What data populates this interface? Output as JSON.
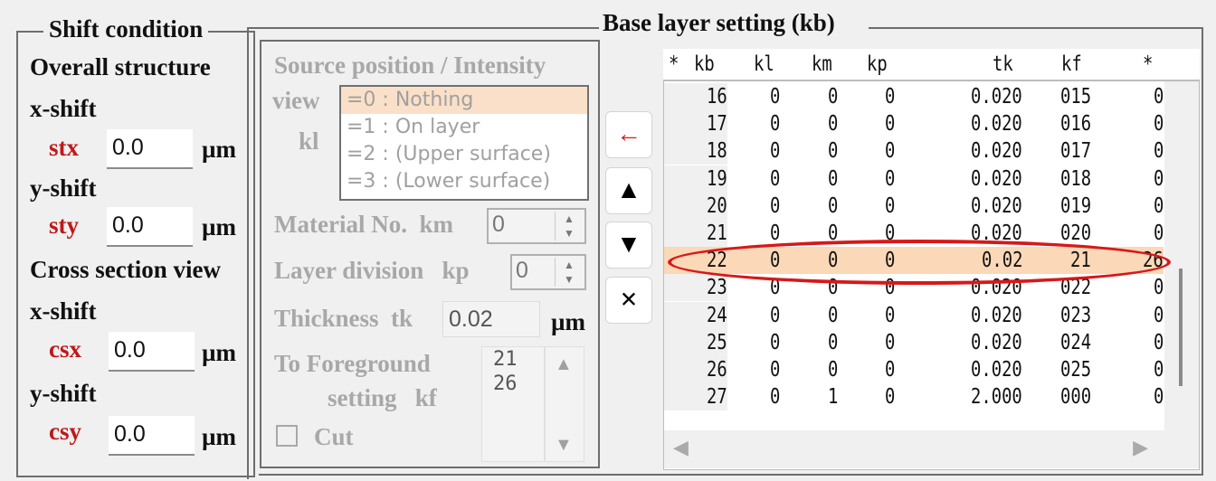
{
  "shift_condition": {
    "title": "Shift condition",
    "overall_structure": {
      "heading": "Overall structure",
      "x_shift_label": "x-shift",
      "stx": {
        "label": "stx",
        "value": "0.0",
        "unit": "µm"
      },
      "y_shift_label": "y-shift",
      "sty": {
        "label": "sty",
        "value": "0.0",
        "unit": "µm"
      }
    },
    "cross_section": {
      "heading": "Cross section view",
      "x_shift_label": "x-shift",
      "csx": {
        "label": "csx",
        "value": "0.0",
        "unit": "µm"
      },
      "y_shift_label": "y-shift",
      "csy": {
        "label": "csy",
        "value": "0.0",
        "unit": "µm"
      }
    }
  },
  "base_layer": {
    "title": "Base layer setting (kb)",
    "source": {
      "heading": "Source position / Intensity",
      "view_label": "view",
      "kl_label": "kl",
      "kl_options": [
        "=0 : Nothing",
        "=1 : On layer",
        "=2 : (Upper surface)",
        "=3 : (Lower surface)"
      ],
      "kl_selected": "=0 : Nothing",
      "material_label": "Material No.  km",
      "km_value": "0",
      "layer_division_label": "Layer division   kp",
      "kp_value": "0",
      "thickness_label": "Thickness  tk",
      "tk_value": "0.02",
      "tk_unit": "µm",
      "foreground_label_1": "To Foreground",
      "foreground_label_2": "setting   kf",
      "kf_values": [
        "21",
        "26"
      ],
      "cut_label": "Cut",
      "cut_checked": false
    },
    "buttons": {
      "apply": "←",
      "move_up": "▲",
      "move_down": "▼",
      "delete": "×"
    },
    "table": {
      "columns": [
        "*",
        "kb",
        "kl",
        "km",
        "kp",
        "tk",
        "kf",
        "*"
      ],
      "rows": [
        {
          "kb": "16",
          "kl": "0",
          "km": "0",
          "kp": "0",
          "tk": "0.020",
          "kf": "015",
          "x": "0"
        },
        {
          "kb": "17",
          "kl": "0",
          "km": "0",
          "kp": "0",
          "tk": "0.020",
          "kf": "016",
          "x": "0"
        },
        {
          "kb": "18",
          "kl": "0",
          "km": "0",
          "kp": "0",
          "tk": "0.020",
          "kf": "017",
          "x": "0"
        },
        {
          "kb": "19",
          "kl": "0",
          "km": "0",
          "kp": "0",
          "tk": "0.020",
          "kf": "018",
          "x": "0"
        },
        {
          "kb": "20",
          "kl": "0",
          "km": "0",
          "kp": "0",
          "tk": "0.020",
          "kf": "019",
          "x": "0"
        },
        {
          "kb": "21",
          "kl": "0",
          "km": "0",
          "kp": "0",
          "tk": "0.020",
          "kf": "020",
          "x": "0"
        },
        {
          "kb": "22",
          "kl": "0",
          "km": "0",
          "kp": "0",
          "tk": "0.02",
          "kf": "21",
          "x": "26"
        },
        {
          "kb": "23",
          "kl": "0",
          "km": "0",
          "kp": "0",
          "tk": "0.020",
          "kf": "022",
          "x": "0"
        },
        {
          "kb": "24",
          "kl": "0",
          "km": "0",
          "kp": "0",
          "tk": "0.020",
          "kf": "023",
          "x": "0"
        },
        {
          "kb": "25",
          "kl": "0",
          "km": "0",
          "kp": "0",
          "tk": "0.020",
          "kf": "024",
          "x": "0"
        },
        {
          "kb": "26",
          "kl": "0",
          "km": "0",
          "kp": "0",
          "tk": "0.020",
          "kf": "025",
          "x": "0"
        },
        {
          "kb": "27",
          "kl": "0",
          "km": "1",
          "kp": "0",
          "tk": "2.000",
          "kf": "000",
          "x": "0"
        }
      ],
      "selected_kb": "22"
    }
  },
  "colors": {
    "selection": "#fad8b8",
    "highlight_ellipse": "#d81818",
    "label_red": "#c01818",
    "disabled_gray": "#a8a8a8"
  }
}
